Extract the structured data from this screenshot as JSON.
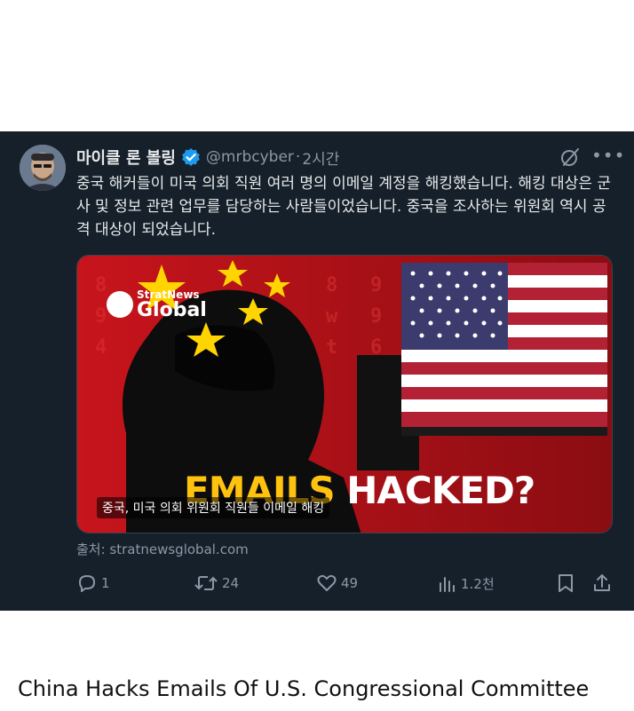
{
  "tweet": {
    "display_name": "마이클 론 볼링",
    "handle": "@mrbcyber",
    "separator": "·",
    "time": "2시간",
    "text": "중국 해커들이 미국 의회 직원 여러 명의 이메일 계정을 해킹했습니다. 해킹 대상은 군사 및 정보 관련 업무를 담당하는 사람들이었습니다. 중국을 조사하는 위원회 역시 공격 대상이 되었습니다.",
    "icons": {
      "verified": "verified-badge-icon",
      "grok": "grok-icon",
      "more": "more-icon"
    }
  },
  "media": {
    "logo_top": "StratNews",
    "logo_bottom": "Global",
    "headline_part1": "EMAILS",
    "headline_part2": "HACKED?",
    "caption": "중국, 미국 의회 위원회 직원들 이메일 해킹"
  },
  "source": {
    "label": "출처: stratnewsglobal.com"
  },
  "actions": {
    "replies": "1",
    "reposts": "24",
    "likes": "49",
    "views": "1.2천"
  },
  "colors": {
    "card_bg": "#15202b",
    "text": "#e7e9ea",
    "muted": "#8b98a5",
    "verified": "#1d9bf0",
    "image_red": "#b5121b"
  },
  "page_caption": "China Hacks Emails Of U.S. Congressional Committee"
}
